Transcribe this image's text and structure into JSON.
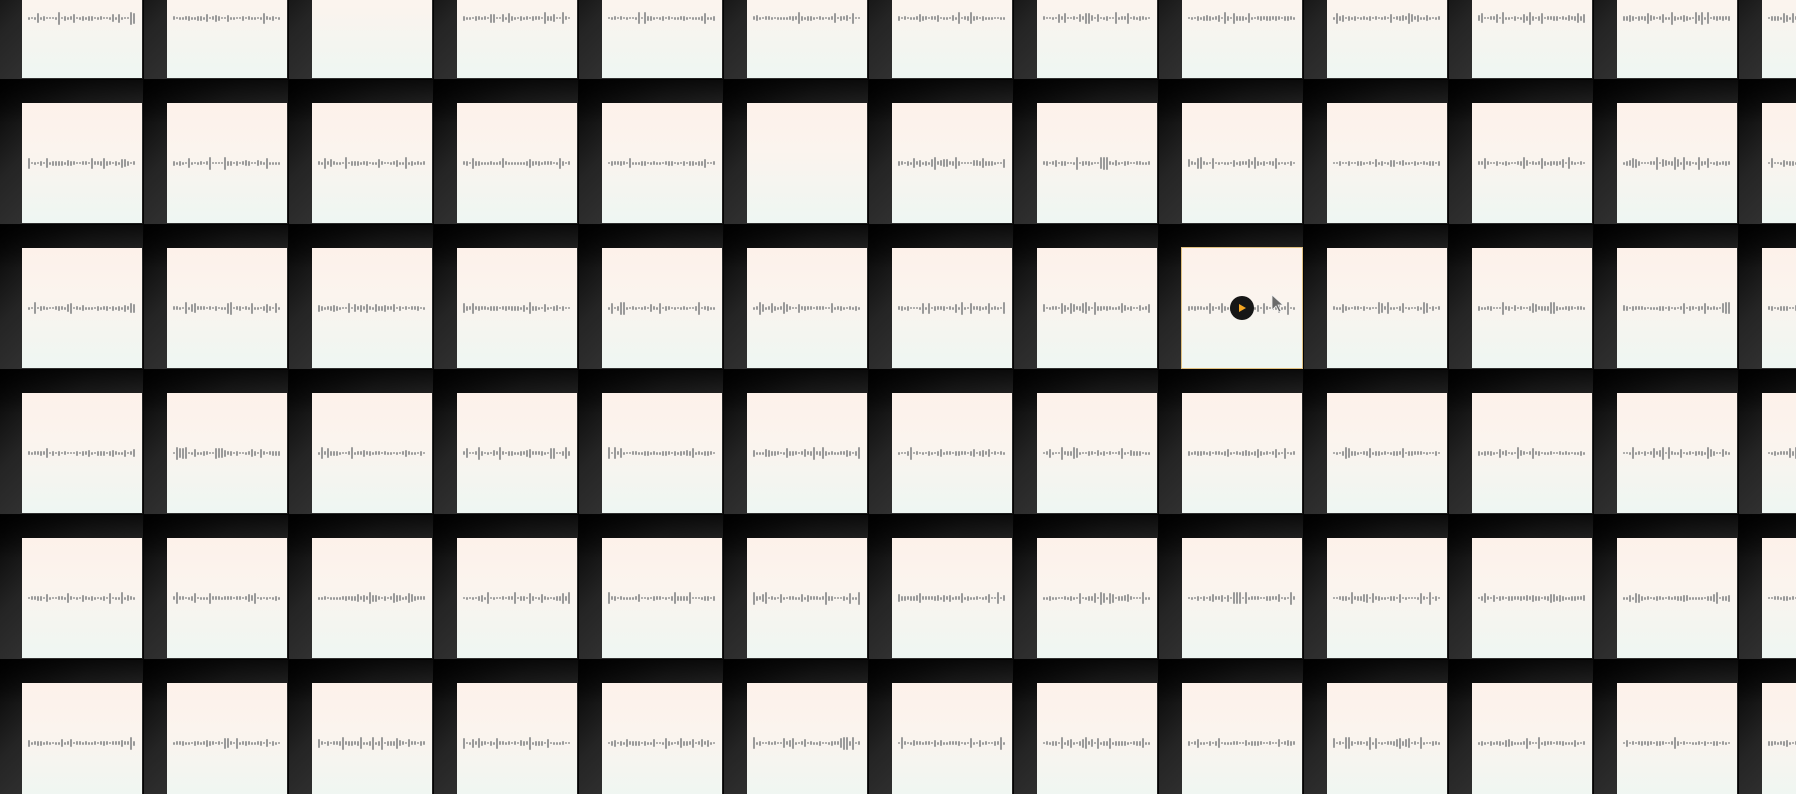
{
  "grid": {
    "columns": 13,
    "rows": 6,
    "hovered_tile": {
      "row": 2,
      "col": 8
    }
  },
  "colors": {
    "background": "#030303",
    "card_top": "#fdf1ea",
    "card_bottom": "#eef6f2",
    "waveform": "#9a9a9a",
    "play_button": "#161616",
    "play_icon": "#f5a623"
  },
  "icons": {
    "play": "play-icon",
    "cursor": "mouse-cursor-icon"
  }
}
